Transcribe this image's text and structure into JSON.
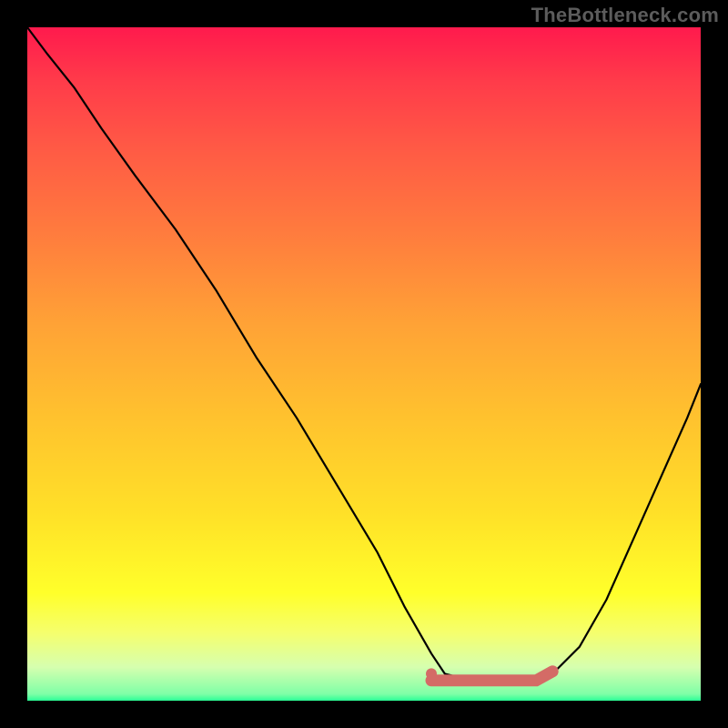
{
  "watermark": "TheBottleneck.com",
  "chart_data": {
    "type": "line",
    "title": "",
    "xlabel": "",
    "ylabel": "",
    "xlim": [
      0,
      100
    ],
    "ylim": [
      0,
      100
    ],
    "grid": false,
    "series": [
      {
        "name": "bottleneck-curve",
        "x": [
          0,
          3,
          7,
          11,
          16,
          22,
          28,
          34,
          40,
          46,
          52,
          56,
          60,
          62,
          66,
          72,
          78,
          82,
          86,
          90,
          94,
          98,
          100
        ],
        "y": [
          100,
          96,
          91,
          85,
          78,
          70,
          61,
          51,
          42,
          32,
          22,
          14,
          7,
          4,
          3,
          3,
          4,
          8,
          15,
          24,
          33,
          42,
          47
        ]
      }
    ],
    "highlight_region": {
      "name": "optimal-range",
      "x_start": 60,
      "x_end": 78,
      "y": 3,
      "color": "#d46b66"
    },
    "highlight_point": {
      "x": 60,
      "y": 4,
      "color": "#d46b66"
    },
    "background_gradient": {
      "top": "#ff1a4d",
      "mid": "#ffe028",
      "bottom": "#2aff96"
    }
  }
}
